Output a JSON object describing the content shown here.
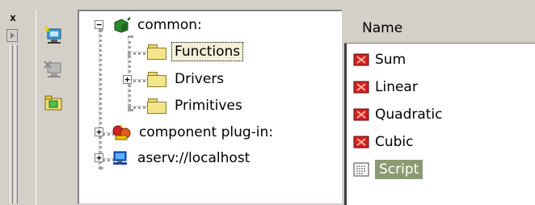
{
  "dock": {
    "close_label": "x"
  },
  "toolbar": {
    "buttons": [
      {
        "icon": "add-server-icon"
      },
      {
        "icon": "remove-server-icon"
      },
      {
        "icon": "open-folder-icon"
      }
    ]
  },
  "tree": {
    "root_common": "common:",
    "functions": "Functions",
    "drivers": "Drivers",
    "primitives": "Primitives",
    "component_plugin": "component plug-in:",
    "aserv": "aserv://localhost"
  },
  "list": {
    "column_name": "Name",
    "items": [
      "Sum",
      "Linear",
      "Quadratic",
      "Cubic",
      "Script"
    ]
  }
}
